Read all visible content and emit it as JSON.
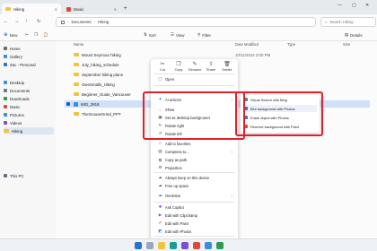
{
  "titlebar": {
    "tabs": [
      {
        "label": "Hiking",
        "active": true
      },
      {
        "label": "Music",
        "active": false
      }
    ],
    "new_tab": "+"
  },
  "address": {
    "path": [
      "Documents",
      "Hiking"
    ],
    "search_placeholder": "Search Hiking"
  },
  "commandbar": {
    "new_label": "New",
    "sort_label": "Sort",
    "view_label": "View",
    "filter_label": "Filter",
    "details_label": "Details"
  },
  "sidebar": {
    "items": [
      {
        "label": "Home",
        "icon": "home-icon",
        "color": "#6a6a6a"
      },
      {
        "label": "Gallery",
        "icon": "gallery-icon",
        "color": "#3a8fd9"
      },
      {
        "label": "Zac - Personal",
        "icon": "onedrive-icon",
        "color": "#2a72d0"
      },
      {
        "label": "Desktop",
        "icon": "desktop-icon",
        "color": "#3a8fd9"
      },
      {
        "label": "Documents",
        "icon": "documents-icon",
        "color": "#5f7f9f"
      },
      {
        "label": "Downloads",
        "icon": "downloads-icon",
        "color": "#2b9a55"
      },
      {
        "label": "Music",
        "icon": "music-icon",
        "color": "#d94a3a"
      },
      {
        "label": "Pictures",
        "icon": "pictures-icon",
        "color": "#3a8fd9"
      },
      {
        "label": "Videos",
        "icon": "videos-icon",
        "color": "#7a4fd0"
      },
      {
        "label": "Hiking",
        "icon": "folder-icon",
        "color": "#f3c33c",
        "selected": true
      },
      {
        "label": "This PC",
        "icon": "computer-icon",
        "color": "#5a6f8a"
      }
    ]
  },
  "filelist": {
    "columns": [
      "Name",
      "Date Modified",
      "Type",
      "Size"
    ],
    "rows": [
      {
        "name": "Mount Seymour hiking",
        "date": "10/11/2024 3:00 PM",
        "type": "folder"
      },
      {
        "name": "July_hiking_schedule",
        "date": "",
        "type": "folder"
      },
      {
        "name": "September hiking plans",
        "date": "",
        "type": "folder"
      },
      {
        "name": "OwnSmalls_Hiking",
        "date": "",
        "type": "folder"
      },
      {
        "name": "Beginner_Guide_Vancouver",
        "date": "",
        "type": "folder"
      },
      {
        "name": "IMG_2918",
        "date": "",
        "type": "image",
        "selected": true
      },
      {
        "name": "TheGrouseGrind_PPT",
        "date": "",
        "type": "folder"
      }
    ]
  },
  "context_menu": {
    "top_actions": [
      {
        "label": "Cut",
        "icon": "cut-icon",
        "glyph": "✂"
      },
      {
        "label": "Copy",
        "icon": "copy-icon",
        "glyph": "❐"
      },
      {
        "label": "Rename",
        "icon": "rename-icon",
        "glyph": "✎"
      },
      {
        "label": "Share",
        "icon": "share-icon",
        "glyph": "⇪"
      },
      {
        "label": "Delete",
        "icon": "delete-icon",
        "glyph": "🗑"
      }
    ],
    "items": [
      {
        "label": "Open",
        "icon": "open-icon",
        "glyph": "▢"
      },
      {
        "label": "AI actions",
        "icon": "ai-actions-icon",
        "glyph": "✦",
        "submenu": true
      },
      {
        "label": "Show",
        "icon": "show-icon",
        "glyph": "▫"
      },
      {
        "label": "Set as desktop background",
        "icon": "wallpaper-icon",
        "glyph": "▣"
      },
      {
        "label": "Rotate right",
        "icon": "rotate-right-icon",
        "glyph": "↻"
      },
      {
        "label": "Rotate left",
        "icon": "rotate-left-icon",
        "glyph": "↺"
      },
      {
        "label": "Add to favorites",
        "icon": "star-icon",
        "glyph": "☆"
      },
      {
        "label": "Compress to...",
        "icon": "compress-icon",
        "glyph": "▤",
        "submenu": true
      },
      {
        "label": "Copy as path",
        "icon": "path-icon",
        "glyph": "⧉"
      },
      {
        "label": "Properties",
        "icon": "properties-icon",
        "glyph": "⚙"
      },
      {
        "label": "Always keep on this device",
        "icon": "cloud-check-icon",
        "glyph": "☁"
      },
      {
        "label": "Free up space",
        "icon": "cloud-icon",
        "glyph": "☁"
      },
      {
        "label": "OneDrive",
        "icon": "onedrive-icon",
        "glyph": "☁",
        "submenu": true
      },
      {
        "label": "Ask Copilot",
        "icon": "copilot-icon",
        "glyph": "✺"
      },
      {
        "label": "Edit with Clipchamp",
        "icon": "clipchamp-icon",
        "glyph": "▶"
      },
      {
        "label": "Edit with Paint",
        "icon": "paint-icon",
        "glyph": "✐"
      },
      {
        "label": "Edit with Photos",
        "icon": "photos-icon",
        "glyph": "◩"
      }
    ],
    "more_options": "Show more options"
  },
  "ai_submenu": {
    "items": [
      {
        "label": "Visual Search with Bing",
        "icon": "bing-search-icon"
      },
      {
        "label": "Blur background with Photos",
        "icon": "blur-background-icon",
        "highlighted": true
      },
      {
        "label": "Erase object with Photos",
        "icon": "erase-object-icon"
      },
      {
        "label": "Remove background with Paint",
        "icon": "remove-background-icon"
      }
    ]
  },
  "colors": {
    "highlight_frame": "#e0202a",
    "accent": "#0a66c2"
  }
}
